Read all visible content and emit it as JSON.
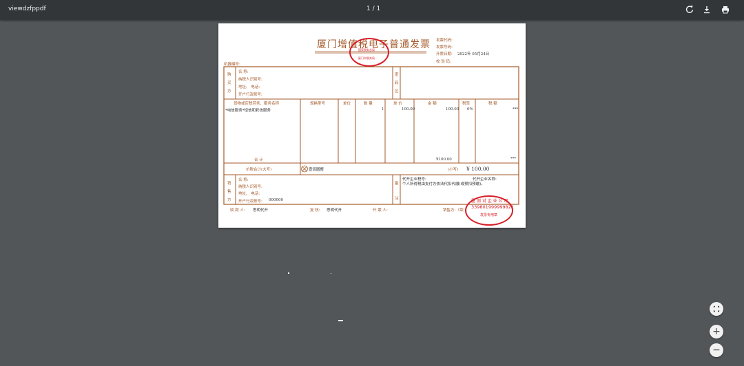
{
  "toolbar": {
    "title": "viewdzfppdf",
    "page_indicator": "1 / 1",
    "icons": [
      "rotate-icon",
      "download-icon",
      "print-icon"
    ]
  },
  "invoice": {
    "title": "厦门增值税电子普通发票",
    "header_labels": {
      "invoice_code": "发票代码:",
      "invoice_number": "发票号码:",
      "issue_date_label": "开票日期:",
      "issue_date_value": "2022年 05月24日",
      "check_code": "校 验 码:",
      "machine_no": "机器编号:"
    },
    "buyer": {
      "side_label": [
        "购",
        "买",
        "方"
      ],
      "name": "名          称:",
      "tax_id": "纳税人识别号:",
      "address": "地址、    电话:",
      "bank": "开户行及账号:"
    },
    "password_area": [
      "密",
      "码",
      "区"
    ],
    "columns": [
      "货物或应税劳务、服务名称",
      "规格型号",
      "单位",
      "数  量",
      "单  价",
      "金  额",
      "税率",
      "税  额"
    ],
    "items": [
      {
        "name": "*电信服务*短信和彩信服务",
        "spec": "",
        "unit": "",
        "qty": "1",
        "price": "100.00",
        "amount": "100.00",
        "rate": "0%",
        "tax": "***"
      }
    ],
    "subtotal_label": "合          计",
    "subtotal_amount": "¥100.00",
    "subtotal_tax": "***",
    "total_label": "价税合计(大写)",
    "total_words": "壹佰圆整",
    "small_label": "(小写)",
    "total_small": "¥ 100.00",
    "seller": {
      "side_label": [
        "销",
        "售",
        "方"
      ],
      "name": "名          称:",
      "tax_id": "纳税人识别号:",
      "address": "地址、    电话:",
      "bank": "开户行及账号:",
      "bank_value": "000000"
    },
    "remarks_label": [
      "备",
      "注"
    ],
    "remarks": {
      "agent_tax_id": "代开企业税号:",
      "agent_name": "代开企业名称:",
      "note": "个人所得税由支付方依法代扣代缴(或预扣预缴)。"
    },
    "footer": {
      "payee_label": "收 款 人:",
      "payee": "思明代开",
      "reviewer_label": "复  核:",
      "reviewer": "思明代开",
      "drawer_label": "开 票 人:",
      "seller_seal_label": "销售方:（章）"
    },
    "stamp_top": {
      "line1": "国家税务总局",
      "line2": "厦门市税务局"
    },
    "stamp_seller": {
      "arc_text": "厦 测 试 企 业 公 司",
      "number": "339801999999821",
      "line3": "发票专用章"
    }
  },
  "controls": {
    "fit_icon": "fit-page-icon",
    "zoom_in": "+",
    "zoom_out": "−"
  },
  "colors": {
    "toolbar_bg": "#323639",
    "viewer_bg": "#525659",
    "invoice_line": "#a45a2a",
    "stamp_red": "#d61f28"
  }
}
